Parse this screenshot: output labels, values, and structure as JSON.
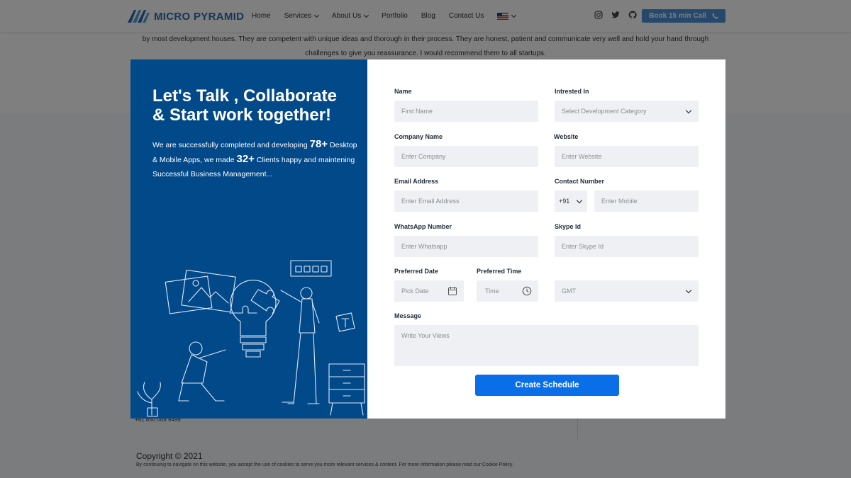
{
  "navbar": {
    "logo_text": "MICRO PYRAMID",
    "links": [
      {
        "label": "Home",
        "has_dropdown": false
      },
      {
        "label": "Services",
        "has_dropdown": true
      },
      {
        "label": "About Us",
        "has_dropdown": true
      },
      {
        "label": "Portfolio",
        "has_dropdown": false
      },
      {
        "label": "Blog",
        "has_dropdown": false
      },
      {
        "label": "Contact Us",
        "has_dropdown": false
      }
    ],
    "language_flag": "us-flag-icon",
    "social_icons": [
      "instagram-icon",
      "twitter-icon",
      "github-icon"
    ],
    "book_call_label": "Book 15 min Call",
    "book_call_icon": "phone-icon",
    "accent_color": "#4a90d9"
  },
  "background": {
    "testimonial_line1": "by most development houses. They are competent with unique ideas and thorough in their process. They are honest, patient and communicate very well and hold your hand through",
    "testimonial_line2": "challenges to give you reassurance. I would recommend them to all startups.",
    "phone_text": "+91 850 009 9499.",
    "copyright": "Copyright © 2021",
    "cookie_notice": "By continuing to navigate on this website, you accept the use of cookies to serve you more relevant services & content. For more information please read our Cookie Policy."
  },
  "modal": {
    "left": {
      "title": "Let's Talk , Collaborate & Start work together!",
      "desc_part1": "We are successfully completed and developing ",
      "apps_count": "78+",
      "desc_part2": " Desktop & Mobile Apps, we made ",
      "clients_count": "32+",
      "desc_part3": " Clients happy and maintening Successful Business Management...",
      "background_color": "#02498a"
    },
    "form": {
      "name_label": "Name",
      "name_placeholder": "First Name",
      "interested_label": "Intrested In",
      "interested_value": "Select Development Category",
      "company_label": "Company Name",
      "company_placeholder": "Enter Company",
      "website_label": "Website",
      "website_placeholder": "Enter Website",
      "email_label": "Email Address",
      "email_placeholder": "Enter Email Address",
      "contact_label": "Contact Number",
      "country_code": "+91",
      "mobile_placeholder": "Enter Mobile",
      "whatsapp_label": "WhatsApp Number",
      "whatsapp_placeholder": "Enter Whatsapp",
      "skype_label": "Skype Id",
      "skype_placeholder": "Enter Skype Id",
      "date_label": "Preferred Date",
      "date_placeholder": "Pick Date",
      "time_label": "Preferred Time",
      "time_placeholder": "Time",
      "timezone_value": "GMT",
      "message_label": "Message",
      "message_placeholder": "Write Your Views",
      "submit_label": "Create Schedule",
      "submit_color": "#0a6ee8"
    }
  }
}
